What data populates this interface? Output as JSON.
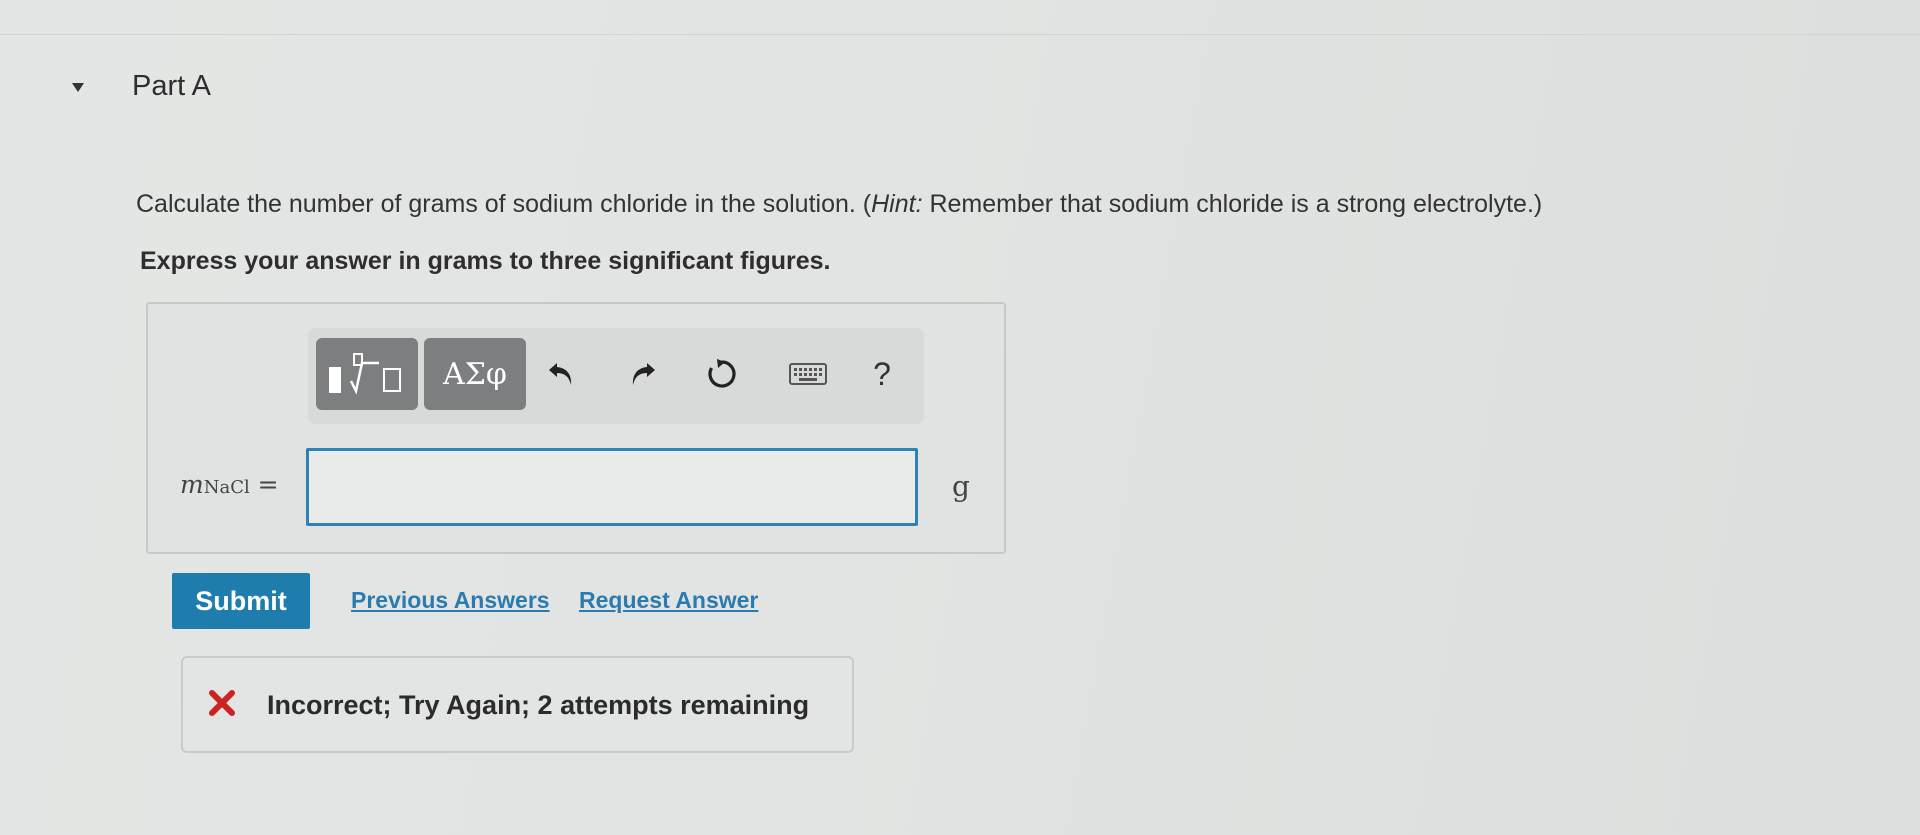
{
  "part": {
    "title": "Part A"
  },
  "question": {
    "text_before_hint": "Calculate the number of grams of sodium chloride in the solution. (",
    "hint_label": "Hint:",
    "hint_text": " Remember that sodium chloride is a strong electrolyte.)",
    "instruction": "Express your answer in grams to three significant figures."
  },
  "toolbar": {
    "greek_label": "ΑΣφ",
    "help_label": "?",
    "icons": [
      "templates-icon",
      "undo-icon",
      "redo-icon",
      "reset-icon",
      "keyboard-icon",
      "help-icon"
    ]
  },
  "answer": {
    "variable": "m",
    "subscript": "NaCl",
    "equals": " =",
    "value": "",
    "unit": "g"
  },
  "actions": {
    "submit_label": "Submit",
    "previous_answers_label": "Previous Answers",
    "request_answer_label": "Request Answer"
  },
  "feedback": {
    "message": "Incorrect; Try Again; 2 attempts remaining"
  },
  "colors": {
    "accent": "#1f7dae",
    "link": "#2a7cb0",
    "error": "#cc2222",
    "toolbar_button": "#7c7e80"
  }
}
